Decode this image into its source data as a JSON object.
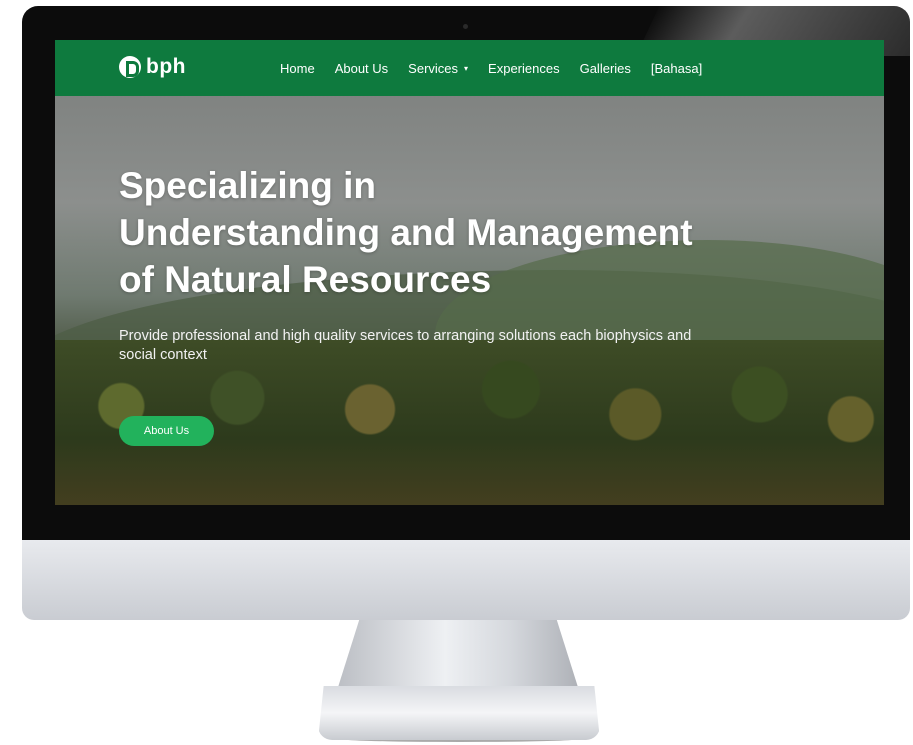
{
  "brand": {
    "logo_text": "bph",
    "accent": "#0e7a3e",
    "button_color": "#22b25c"
  },
  "nav": {
    "items": [
      {
        "label": "Home"
      },
      {
        "label": "About Us"
      },
      {
        "label": "Services",
        "has_dropdown": true,
        "caret": "▾"
      },
      {
        "label": "Experiences"
      },
      {
        "label": "Galleries"
      },
      {
        "label": "[Bahasa]"
      }
    ]
  },
  "hero": {
    "headline": [
      "Specializing in",
      "Understanding and Management",
      "of Natural Resources"
    ],
    "subtext": "Provide professional and high quality services to arranging solutions each biophysics and social context",
    "cta_label": "About Us"
  }
}
